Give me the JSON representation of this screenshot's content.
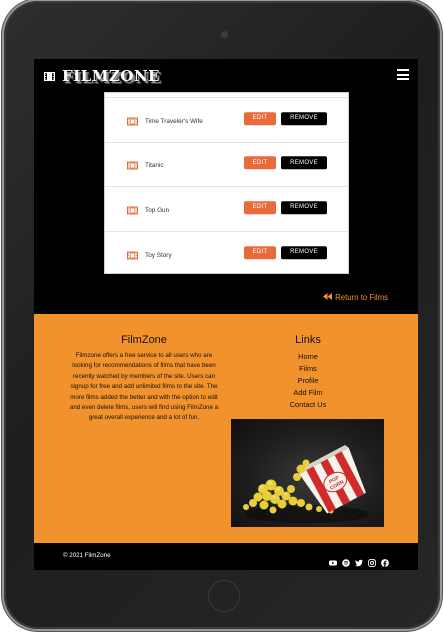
{
  "navbar": {
    "brand": "FILMZONE",
    "brand_icon": "film-icon",
    "menu_icon": "hamburger-menu-icon"
  },
  "films": [
    {
      "title": "Time Traveler's Wife",
      "edit_label": "EDIT",
      "remove_label": "REMOVE"
    },
    {
      "title": "Titanic",
      "edit_label": "EDIT",
      "remove_label": "REMOVE"
    },
    {
      "title": "Top Gun",
      "edit_label": "EDIT",
      "remove_label": "REMOVE"
    },
    {
      "title": "Toy Story",
      "edit_label": "EDIT",
      "remove_label": "REMOVE"
    }
  ],
  "return_link": {
    "label": "Return to Films",
    "icon": "backward-icon"
  },
  "footer": {
    "about_title": "FilmZone",
    "about_text": "Filmzone offers a free service to all users who are looking for recommendations of films that have been recently watched by members of the site. Users can signup for free and add unlimited films to the site. The more films added the better and with the option to edit and even delete films, users will find using FilmZone a great overall experience and a lot of fun.",
    "links_title": "Links",
    "links": [
      "Home",
      "Films",
      "Profile",
      "Add Film",
      "Contact Us"
    ],
    "image": "popcorn-image"
  },
  "bottom_bar": {
    "copyright": "© 2021 FilmZone",
    "social_icons": [
      "youtube-icon",
      "spotify-icon",
      "twitter-icon",
      "instagram-icon",
      "facebook-icon"
    ]
  },
  "colors": {
    "accent_orange": "#f2922c",
    "edit_button": "#e96b3c",
    "background": "#000000"
  }
}
